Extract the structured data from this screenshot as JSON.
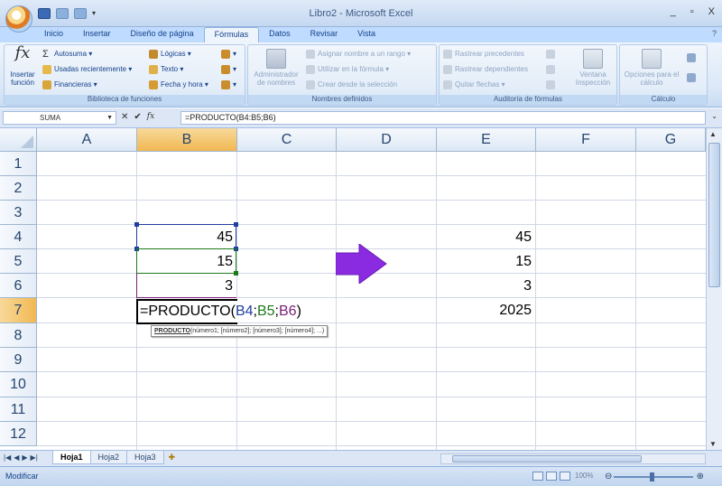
{
  "window": {
    "title": "Libro2 - Microsoft Excel",
    "controls": [
      "_",
      "▫",
      "X"
    ]
  },
  "ribbon": {
    "tabs": [
      "Inicio",
      "Insertar",
      "Diseño de página",
      "Fórmulas",
      "Datos",
      "Revisar",
      "Vista"
    ],
    "active_tab": "Fórmulas",
    "help_icon": "?",
    "groups": {
      "biblioteca": {
        "label": "Biblioteca de funciones",
        "insert_function": "Insertar función",
        "autosum": "Autosuma",
        "recent": "Usadas recientemente",
        "financial": "Financieras",
        "logical": "Lógicas",
        "text": "Texto",
        "datetime": "Fecha y hora"
      },
      "nombres": {
        "label": "Nombres definidos",
        "admin": "Administrador de nombres",
        "assign": "Asignar nombre a un rango",
        "use": "Utilizar en la fórmula",
        "create": "Crear desde la selección"
      },
      "auditoria": {
        "label": "Auditoría de fórmulas",
        "trace_prec": "Rastrear precedentes",
        "trace_dep": "Rastrear dependientes",
        "remove_arrows": "Quitar flechas",
        "watch": "Ventana Inspección"
      },
      "calculo": {
        "label": "Cálculo",
        "options": "Opciones para el cálculo"
      }
    }
  },
  "formula_bar": {
    "name_box": "SUMA",
    "fx": "fx",
    "cancel": "✕",
    "enter": "✔",
    "formula": "=PRODUCTO(B4:B5;B6)"
  },
  "columns": [
    "A",
    "B",
    "C",
    "D",
    "E",
    "F",
    "G"
  ],
  "rows": [
    "1",
    "2",
    "3",
    "4",
    "5",
    "6",
    "7",
    "8",
    "9",
    "10",
    "11",
    "12"
  ],
  "cells": {
    "B4": "45",
    "B5": "15",
    "B6": "3",
    "E4": "45",
    "E5": "15",
    "E6": "3",
    "E7": "2025"
  },
  "editing": {
    "prefix": "=PRODUCTO(",
    "ref1": "B4",
    "sep1": ";",
    "ref2": "B5",
    "sep2": ";",
    "ref3": "B6",
    "suffix": ")"
  },
  "tooltip": {
    "function": "PRODUCTO",
    "args": "(número1; [número2]; [número3]; [número4]; ...)"
  },
  "arrow_color": "#8a2be2",
  "sheets": [
    "Hoja1",
    "Hoja2",
    "Hoja3"
  ],
  "active_sheet": "Hoja1",
  "status": {
    "mode": "Modificar",
    "zoom": "100%"
  }
}
